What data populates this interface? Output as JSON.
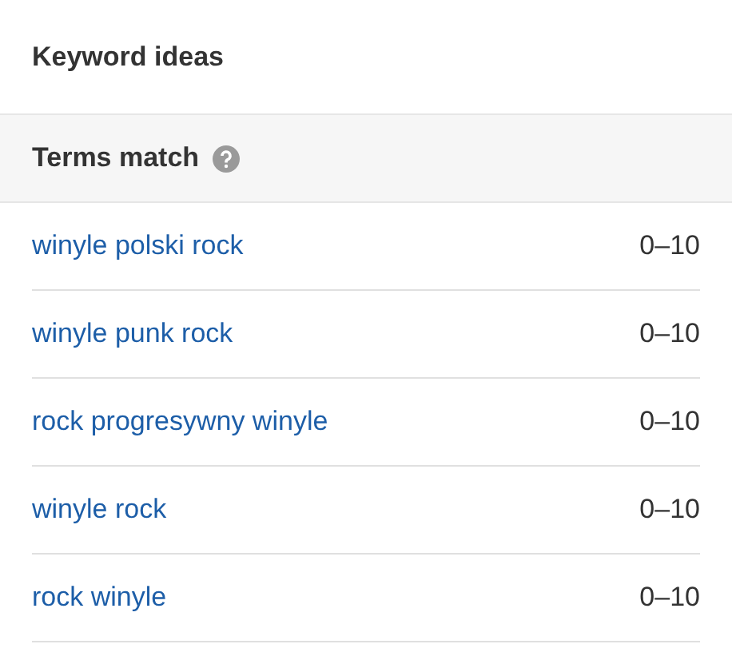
{
  "panel": {
    "title": "Keyword ideas"
  },
  "section": {
    "title": "Terms match",
    "help_icon": true
  },
  "rows": [
    {
      "keyword": "winyle polski rock",
      "volume": "0–10"
    },
    {
      "keyword": "winyle punk rock",
      "volume": "0–10"
    },
    {
      "keyword": "rock progresywny winyle",
      "volume": "0–10"
    },
    {
      "keyword": "winyle rock",
      "volume": "0–10"
    },
    {
      "keyword": "rock winyle",
      "volume": "0–10"
    }
  ]
}
